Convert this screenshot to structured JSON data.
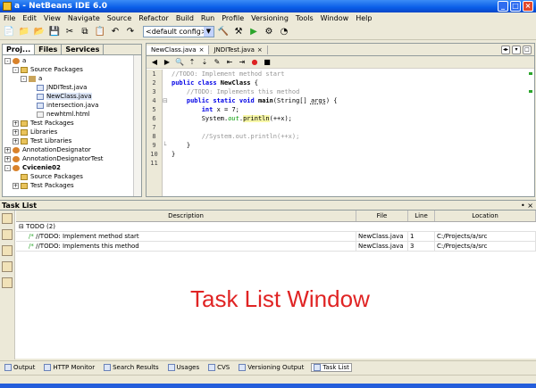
{
  "window": {
    "title": "a - NetBeans IDE 6.0",
    "buttons": [
      "_",
      "□",
      "×"
    ]
  },
  "menu": [
    "File",
    "Edit",
    "View",
    "Navigate",
    "Source",
    "Refactor",
    "Build",
    "Run",
    "Profile",
    "Versioning",
    "Tools",
    "Window",
    "Help"
  ],
  "toolbar": {
    "config": "<default config>"
  },
  "left_panel": {
    "tabs": [
      "Proj...",
      "Files",
      "Services"
    ],
    "tree": [
      {
        "label": "a",
        "depth": 0,
        "icon": "project-icon",
        "exp": "-"
      },
      {
        "label": "Source Packages",
        "depth": 1,
        "icon": "folder-icon",
        "exp": "-"
      },
      {
        "label": "a",
        "depth": 2,
        "icon": "package-icon",
        "exp": "-"
      },
      {
        "label": "JNDITest.java",
        "depth": 3,
        "icon": "java-file-icon",
        "exp": ""
      },
      {
        "label": "NewClass.java",
        "depth": 3,
        "icon": "java-file-icon",
        "exp": "",
        "selected": true
      },
      {
        "label": "intersection.java",
        "depth": 3,
        "icon": "java-file-icon",
        "exp": ""
      },
      {
        "label": "newhtml.html",
        "depth": 3,
        "icon": "html-file-icon",
        "exp": ""
      },
      {
        "label": "Test Packages",
        "depth": 1,
        "icon": "folder-icon",
        "exp": "+"
      },
      {
        "label": "Libraries",
        "depth": 1,
        "icon": "folder-icon",
        "exp": "+"
      },
      {
        "label": "Test Libraries",
        "depth": 1,
        "icon": "folder-icon",
        "exp": "+"
      },
      {
        "label": "AnnotationDesignator",
        "depth": 0,
        "icon": "project-icon",
        "exp": "+"
      },
      {
        "label": "AnnotationDesignatorTest",
        "depth": 0,
        "icon": "project-icon",
        "exp": "+"
      },
      {
        "label": "Cvicenie02",
        "depth": 0,
        "icon": "project-icon",
        "exp": "-",
        "bold": true
      },
      {
        "label": "Source Packages",
        "depth": 1,
        "icon": "folder-icon",
        "exp": ""
      },
      {
        "label": "Test Packages",
        "depth": 1,
        "icon": "folder-icon",
        "exp": "+"
      }
    ]
  },
  "editor": {
    "tabs": [
      "NewClass.java",
      "JNDITest.java"
    ],
    "line_numbers": [
      "1",
      "2",
      "3",
      "4",
      "5",
      "6",
      "7",
      "8",
      "9",
      "10",
      "11"
    ]
  },
  "task_list": {
    "title": "Task List",
    "columns": [
      "Description",
      "File",
      "Line",
      "Location"
    ],
    "group": "TODO (2)",
    "rows": [
      {
        "description": "//TODO: Implement method start",
        "file": "NewClass.java",
        "line": "1",
        "location": "C:/Projects/a/src"
      },
      {
        "description": "//TODO: Implements this method",
        "file": "NewClass.java",
        "line": "3",
        "location": "C:/Projects/a/src"
      }
    ],
    "overlay_text": "Task List Window"
  },
  "bottom_tabs": [
    "Output",
    "HTTP Monitor",
    "Search Results",
    "Usages",
    "CVS",
    "Versioning Output",
    "Task List"
  ]
}
